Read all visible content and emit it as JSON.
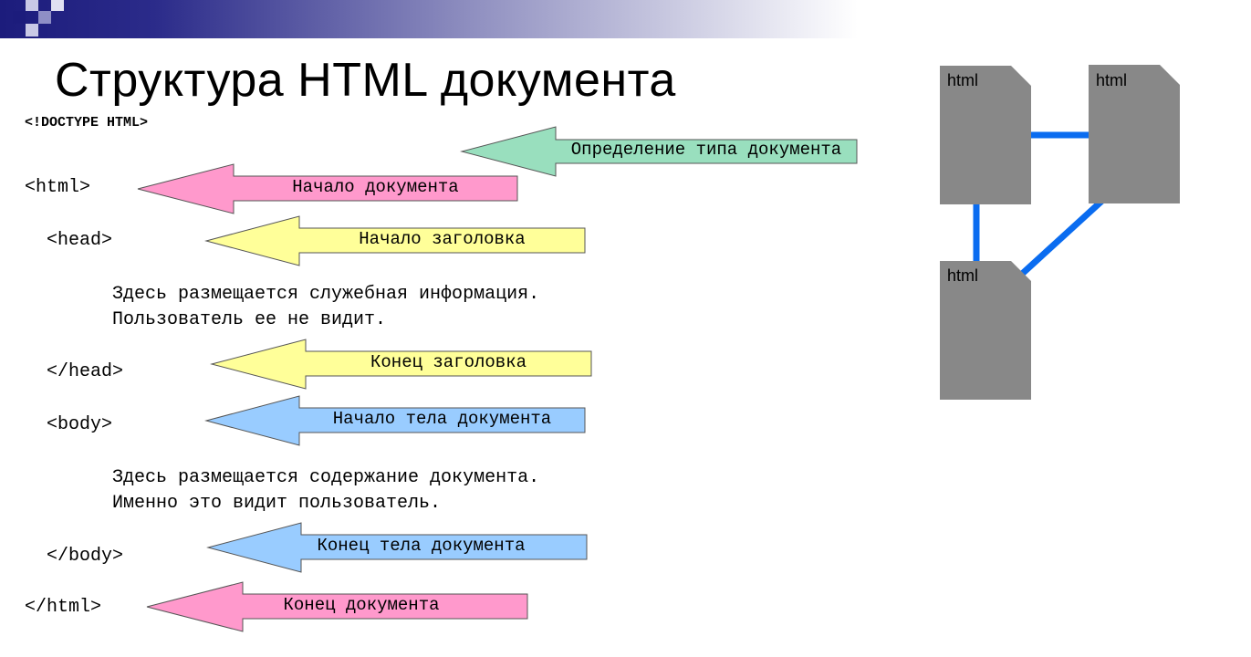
{
  "title": "Структура HTML документа",
  "code": {
    "doctype": "<!DOCTYPE HTML>",
    "html_open": "<html>",
    "head_open": "<head>",
    "head_text_1": "Здесь размещается служебная информация.",
    "head_text_2": "Пользователь ее не видит.",
    "head_close": "</head>",
    "body_open": "<body>",
    "body_text_1": "Здесь размещается содержание документа.",
    "body_text_2": "Именно это видит пользователь.",
    "body_close": "</body>",
    "html_close": "</html>"
  },
  "arrows": {
    "doctype": "Определение типа документа",
    "doc_start": "Начало документа",
    "head_start": "Начало заголовка",
    "head_end": "Конец заголовка",
    "body_start": "Начало тела документа",
    "body_end": "Конец тела документа",
    "doc_end": "Конец документа"
  },
  "diagram": {
    "doc1": "html",
    "doc2": "html",
    "doc3": "html"
  },
  "colors": {
    "green": "#99dfbe",
    "pink": "#ff99cc",
    "yellow": "#ffff99",
    "blue": "#99ccff",
    "doc_gray": "#888888",
    "link_blue": "#0a6cf0"
  }
}
